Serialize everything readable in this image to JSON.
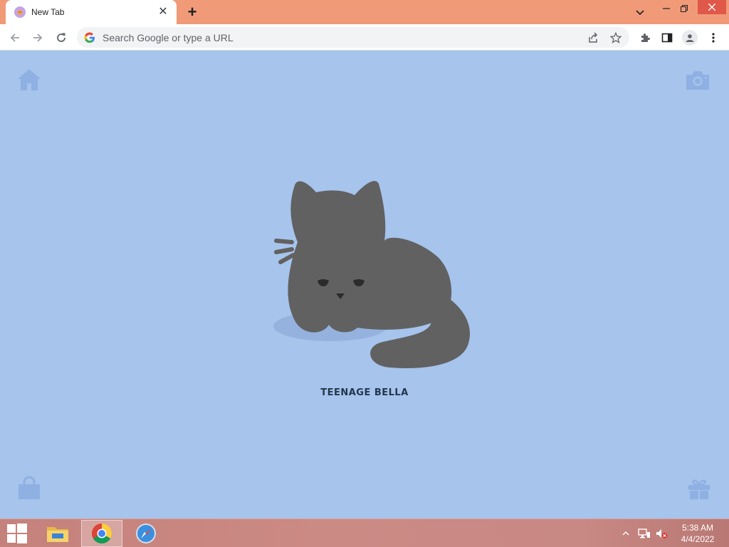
{
  "browser": {
    "tab": {
      "title": "New Tab",
      "close_glyph": "✕"
    },
    "newtab_glyph": "+",
    "window_controls": {
      "minimize": "–",
      "restore": "❐",
      "close": "✕"
    },
    "omnibox": {
      "placeholder": "Search Google or type a URL",
      "value": ""
    }
  },
  "page": {
    "cat_name": "TEENAGE BELLA",
    "icons": [
      "home-icon",
      "camera-icon",
      "shopping-bag-icon",
      "gift-icon"
    ]
  },
  "taskbar": {
    "items": [
      "file-explorer-icon",
      "chrome-icon",
      "safari-icon"
    ],
    "clock": {
      "time": "5:38 AM",
      "date": "4/4/2022"
    }
  },
  "colors": {
    "tabstrip": "#f19a78",
    "page_background": "#a6c4ec",
    "cat": "#616161",
    "corner_icons": "#8fb0e2",
    "cat_name": "#23364d",
    "close_button": "#e0584a"
  }
}
